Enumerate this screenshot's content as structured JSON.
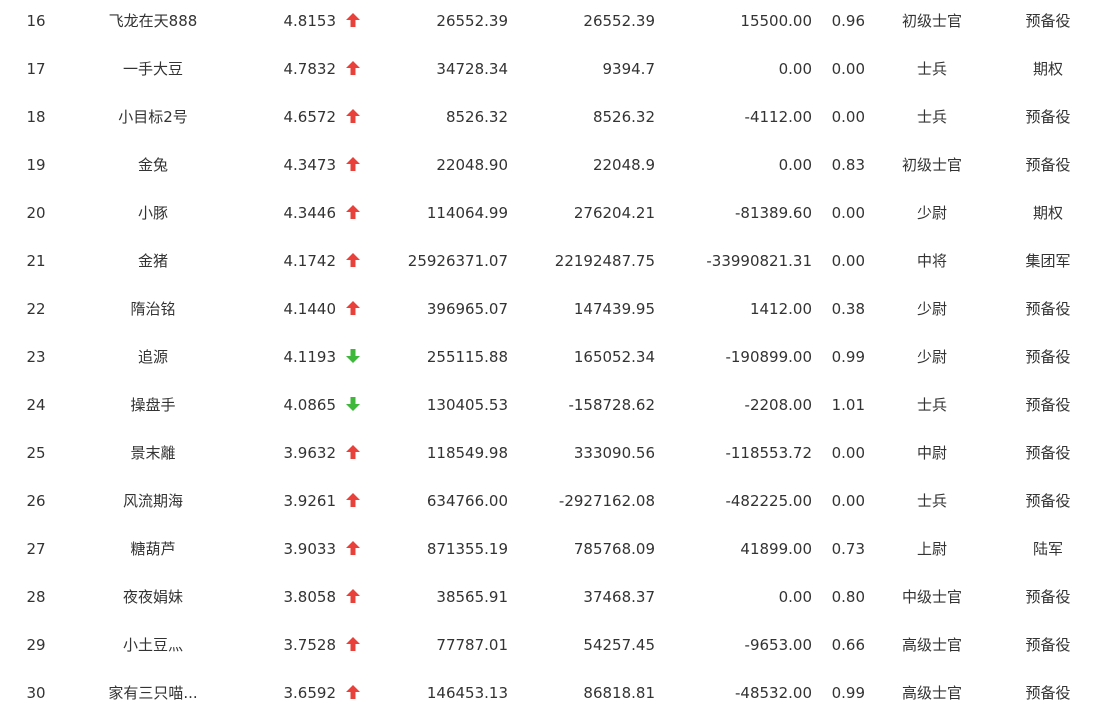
{
  "colors": {
    "up": "#e8413b",
    "down": "#3eb83a",
    "text": "#333333"
  },
  "rows": [
    {
      "rank": "16",
      "name": "飞龙在天888",
      "score": "4.8153",
      "trend": "up",
      "v1": "26552.39",
      "v2": "26552.39",
      "v3": "15500.00",
      "ratio": "0.96",
      "rank_title": "初级士官",
      "category": "预备役"
    },
    {
      "rank": "17",
      "name": "一手大豆",
      "score": "4.7832",
      "trend": "up",
      "v1": "34728.34",
      "v2": "9394.7",
      "v3": "0.00",
      "ratio": "0.00",
      "rank_title": "士兵",
      "category": "期权"
    },
    {
      "rank": "18",
      "name": "小目标2号",
      "score": "4.6572",
      "trend": "up",
      "v1": "8526.32",
      "v2": "8526.32",
      "v3": "-4112.00",
      "ratio": "0.00",
      "rank_title": "士兵",
      "category": "预备役"
    },
    {
      "rank": "19",
      "name": "金兔",
      "score": "4.3473",
      "trend": "up",
      "v1": "22048.90",
      "v2": "22048.9",
      "v3": "0.00",
      "ratio": "0.83",
      "rank_title": "初级士官",
      "category": "预备役"
    },
    {
      "rank": "20",
      "name": "小豚",
      "score": "4.3446",
      "trend": "up",
      "v1": "114064.99",
      "v2": "276204.21",
      "v3": "-81389.60",
      "ratio": "0.00",
      "rank_title": "少尉",
      "category": "期权"
    },
    {
      "rank": "21",
      "name": "金猪",
      "score": "4.1742",
      "trend": "up",
      "v1": "25926371.07",
      "v2": "22192487.75",
      "v3": "-33990821.31",
      "ratio": "0.00",
      "rank_title": "中将",
      "category": "集团军"
    },
    {
      "rank": "22",
      "name": "隋治铭",
      "score": "4.1440",
      "trend": "up",
      "v1": "396965.07",
      "v2": "147439.95",
      "v3": "1412.00",
      "ratio": "0.38",
      "rank_title": "少尉",
      "category": "预备役"
    },
    {
      "rank": "23",
      "name": "追源",
      "score": "4.1193",
      "trend": "down",
      "v1": "255115.88",
      "v2": "165052.34",
      "v3": "-190899.00",
      "ratio": "0.99",
      "rank_title": "少尉",
      "category": "预备役"
    },
    {
      "rank": "24",
      "name": "操盘手",
      "score": "4.0865",
      "trend": "down",
      "v1": "130405.53",
      "v2": "-158728.62",
      "v3": "-2208.00",
      "ratio": "1.01",
      "rank_title": "士兵",
      "category": "预备役"
    },
    {
      "rank": "25",
      "name": "景末離",
      "score": "3.9632",
      "trend": "up",
      "v1": "118549.98",
      "v2": "333090.56",
      "v3": "-118553.72",
      "ratio": "0.00",
      "rank_title": "中尉",
      "category": "预备役"
    },
    {
      "rank": "26",
      "name": "风流期海",
      "score": "3.9261",
      "trend": "up",
      "v1": "634766.00",
      "v2": "-2927162.08",
      "v3": "-482225.00",
      "ratio": "0.00",
      "rank_title": "士兵",
      "category": "预备役"
    },
    {
      "rank": "27",
      "name": "糖葫芦",
      "score": "3.9033",
      "trend": "up",
      "v1": "871355.19",
      "v2": "785768.09",
      "v3": "41899.00",
      "ratio": "0.73",
      "rank_title": "上尉",
      "category": "陆军"
    },
    {
      "rank": "28",
      "name": "夜夜娟妹",
      "score": "3.8058",
      "trend": "up",
      "v1": "38565.91",
      "v2": "37468.37",
      "v3": "0.00",
      "ratio": "0.80",
      "rank_title": "中级士官",
      "category": "预备役"
    },
    {
      "rank": "29",
      "name": "小土豆灬",
      "score": "3.7528",
      "trend": "up",
      "v1": "77787.01",
      "v2": "54257.45",
      "v3": "-9653.00",
      "ratio": "0.66",
      "rank_title": "高级士官",
      "category": "预备役"
    },
    {
      "rank": "30",
      "name": "家有三只喵...",
      "score": "3.6592",
      "trend": "up",
      "v1": "146453.13",
      "v2": "86818.81",
      "v3": "-48532.00",
      "ratio": "0.99",
      "rank_title": "高级士官",
      "category": "预备役"
    }
  ]
}
